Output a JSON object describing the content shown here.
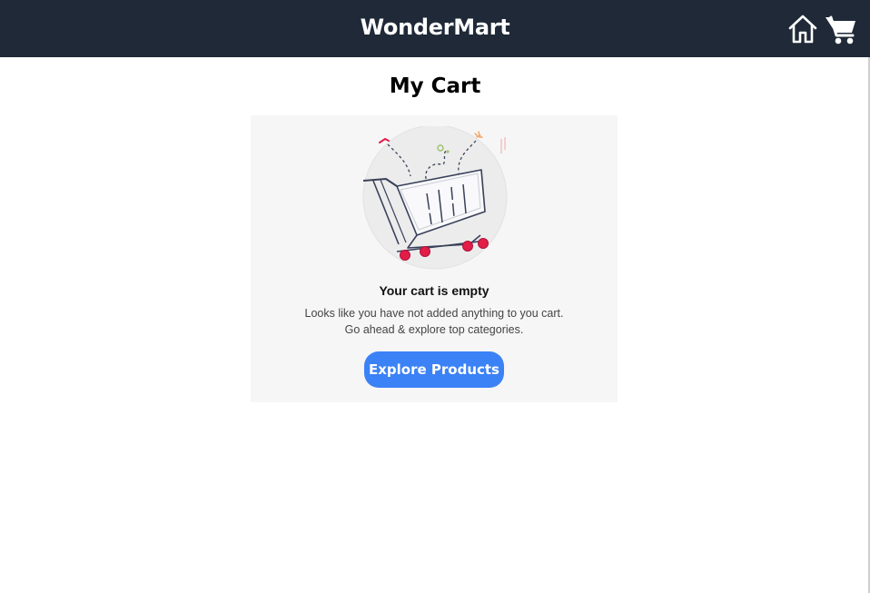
{
  "header": {
    "brand": "WonderMart",
    "icons": [
      "home-icon",
      "cart-icon"
    ]
  },
  "main": {
    "title": "My Cart",
    "empty_state": {
      "illustration": "empty-cart-illustration",
      "title": "Your cart is empty",
      "description": "Looks like you have not added anything to you cart. Go ahead & explore top categories.",
      "button_label": "Explore Products"
    }
  },
  "colors": {
    "navbar": "#1f2937",
    "button": "#3b82f6",
    "card": "#f6f6f6",
    "wheel": "#e11d48"
  }
}
